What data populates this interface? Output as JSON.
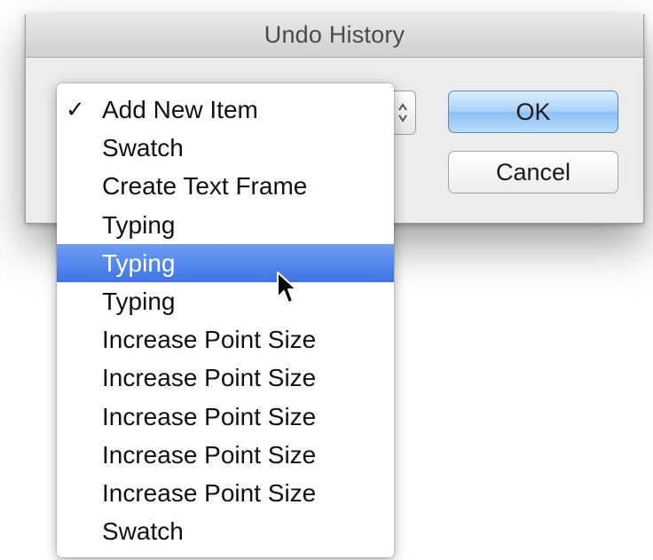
{
  "window": {
    "title": "Undo History"
  },
  "buttons": {
    "ok_label": "OK",
    "cancel_label": "Cancel"
  },
  "menu": {
    "checked_mark": "✓",
    "items": [
      {
        "label": "Add New Item",
        "checked": true,
        "highlighted": false
      },
      {
        "label": "Swatch",
        "checked": false,
        "highlighted": false
      },
      {
        "label": "Create Text Frame",
        "checked": false,
        "highlighted": false
      },
      {
        "label": "Typing",
        "checked": false,
        "highlighted": false
      },
      {
        "label": "Typing",
        "checked": false,
        "highlighted": true
      },
      {
        "label": "Typing",
        "checked": false,
        "highlighted": false
      },
      {
        "label": "Increase Point Size",
        "checked": false,
        "highlighted": false
      },
      {
        "label": "Increase Point Size",
        "checked": false,
        "highlighted": false
      },
      {
        "label": "Increase Point Size",
        "checked": false,
        "highlighted": false
      },
      {
        "label": "Increase Point Size",
        "checked": false,
        "highlighted": false
      },
      {
        "label": "Increase Point Size",
        "checked": false,
        "highlighted": false
      },
      {
        "label": "Swatch",
        "checked": false,
        "highlighted": false
      }
    ]
  },
  "colors": {
    "highlight": "#4a80ea",
    "ok_button": "#a9d1f7"
  },
  "icons": {
    "cursor": "arrow-cursor-icon",
    "popup_arrows": "chevron-updown-icon"
  }
}
